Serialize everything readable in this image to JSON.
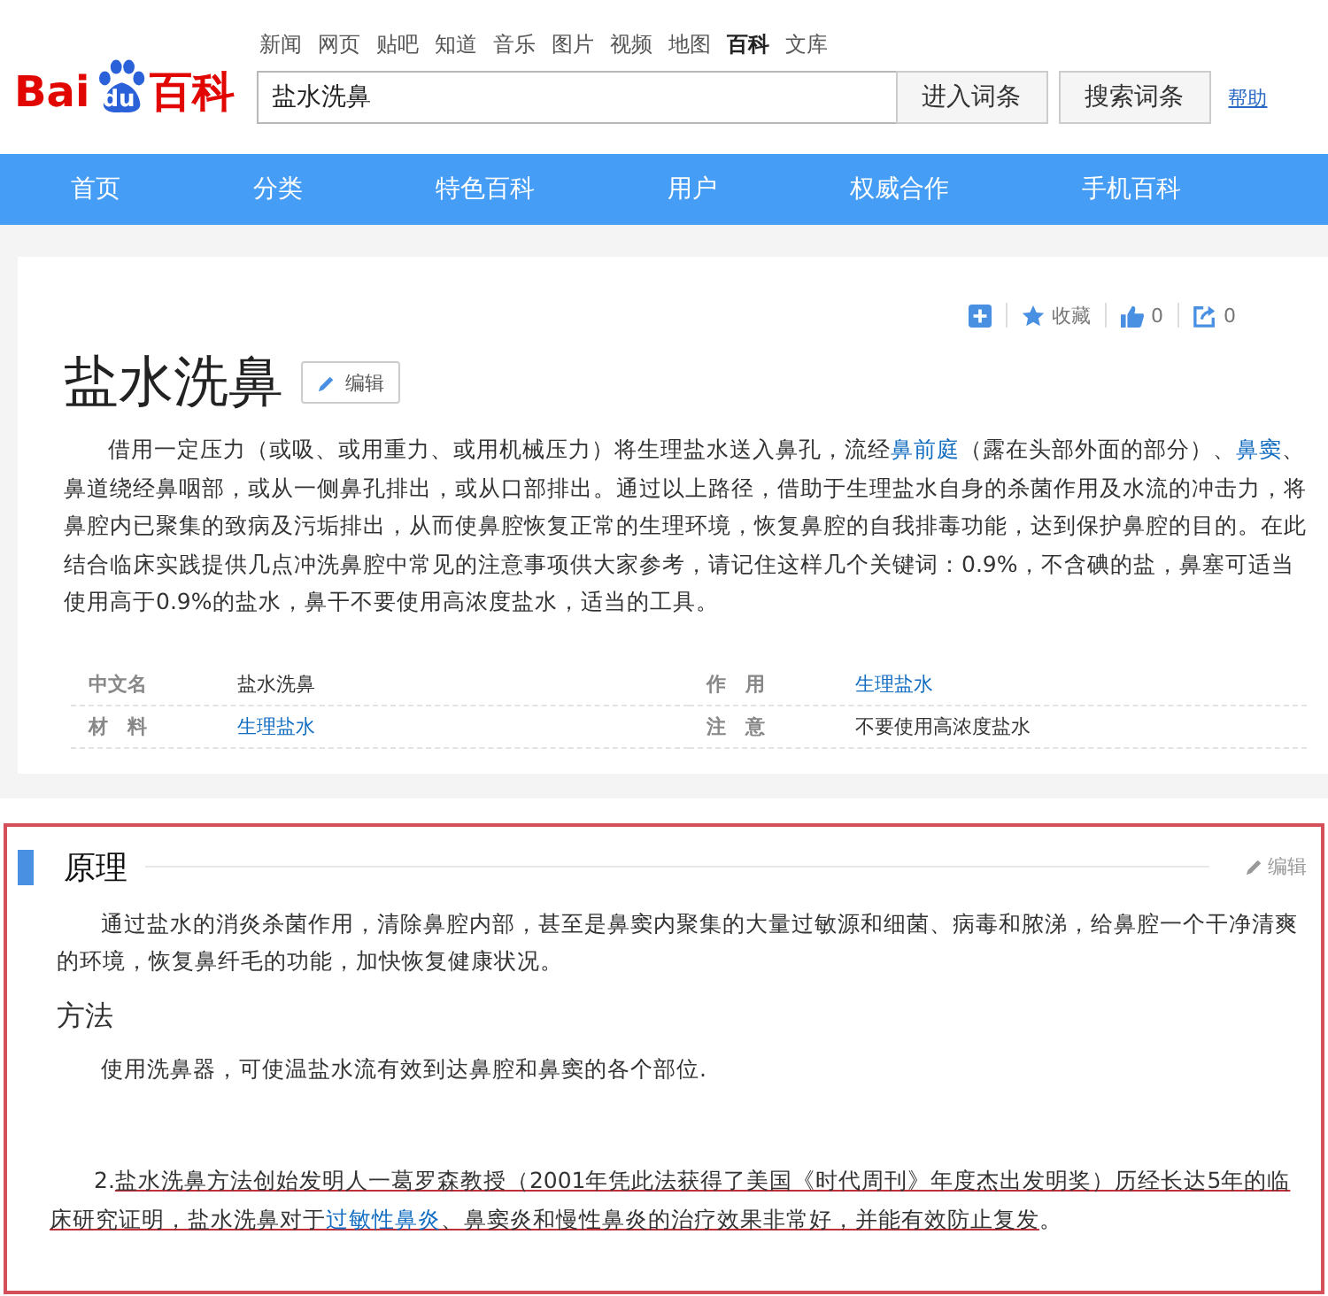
{
  "logo": {
    "left": "Bai",
    "paw": "du",
    "right": "百科"
  },
  "top_links": [
    {
      "label": "新闻",
      "selected": false
    },
    {
      "label": "网页",
      "selected": false
    },
    {
      "label": "贴吧",
      "selected": false
    },
    {
      "label": "知道",
      "selected": false
    },
    {
      "label": "音乐",
      "selected": false
    },
    {
      "label": "图片",
      "selected": false
    },
    {
      "label": "视频",
      "selected": false
    },
    {
      "label": "地图",
      "selected": false
    },
    {
      "label": "百科",
      "selected": true
    },
    {
      "label": "文库",
      "selected": false
    }
  ],
  "search": {
    "value": "盐水洗鼻",
    "buttons": [
      "进入词条",
      "搜索词条"
    ],
    "help": "帮助"
  },
  "nav": [
    "首页",
    "分类",
    "特色百科",
    "用户",
    "权威合作",
    "手机百科"
  ],
  "article": {
    "title": "盐水洗鼻",
    "edit": "编辑",
    "actions": [
      {
        "kind": "add"
      },
      {
        "kind": "star",
        "label": "收藏"
      },
      {
        "kind": "like",
        "label": "0"
      },
      {
        "kind": "share",
        "label": "0"
      }
    ],
    "summary": [
      {
        "kind": "text",
        "text": "借用一定压力（或吸、或用重力、或用机械压力）将生理盐水送入鼻孔，流经"
      },
      {
        "kind": "link",
        "text": "鼻前庭"
      },
      {
        "kind": "text",
        "text": "（露在头部外面的部分）、"
      },
      {
        "kind": "link",
        "text": "鼻窦"
      },
      {
        "kind": "text",
        "text": "、鼻道绕经鼻咽部，或从一侧鼻孔排出，或从口部排出。通过以上路径，借助于生理盐水自身的杀菌作用及水流的冲击力，将鼻腔内已聚集的致病及污垢排出，从而使鼻腔恢复正常的生理环境，恢复鼻腔的自我排毒功能，达到保护鼻腔的目的。在此结合临床实践提供几点冲洗鼻腔中常见的注意事项供大家参考，请记住这样几个关键词：0.9%，不含碘的盐，鼻塞可适当使用高于0.9%的盐水，鼻干不要使用高浓度盐水，适当的工具。"
      }
    ],
    "info": [
      {
        "name": "中文名",
        "value": "盐水洗鼻",
        "kind": "text"
      },
      {
        "name": "作　用",
        "value": "生理盐水",
        "kind": "link"
      },
      {
        "name": "材　料",
        "value": "生理盐水",
        "kind": "link"
      },
      {
        "name": "注　意",
        "value": "不要使用高浓度盐水",
        "kind": "text"
      }
    ]
  },
  "section": {
    "title": "原理",
    "edit": "编辑",
    "paragraph": "通过盐水的消炎杀菌作用，清除鼻腔内部，甚至是鼻窦内聚集的大量过敏源和细菌、病毒和脓涕，给鼻腔一个干净清爽的环境，恢复鼻纤毛的功能，加快恢复健康状况。",
    "subtitle": "方法",
    "method": "使用洗鼻器，可使温盐水流有效到达鼻腔和鼻窦的各个部位.",
    "note": [
      {
        "kind": "text",
        "text": "2.",
        "underlined": false
      },
      {
        "kind": "text",
        "text": "盐水洗鼻方法创始发明人一葛罗森教授（2001年凭此法获得了美国《时代周刊》年度杰出发明奖）历经长达5年的临床研究证明，盐水洗鼻对于",
        "underlined": true
      },
      {
        "kind": "link",
        "text": "过敏性鼻炎",
        "underlined": true
      },
      {
        "kind": "text",
        "text": "、鼻窦炎和慢性鼻炎的治疗效果非常好，并能有效防止复发",
        "underlined": true
      },
      {
        "kind": "text",
        "text": "。",
        "underlined": false
      }
    ]
  }
}
